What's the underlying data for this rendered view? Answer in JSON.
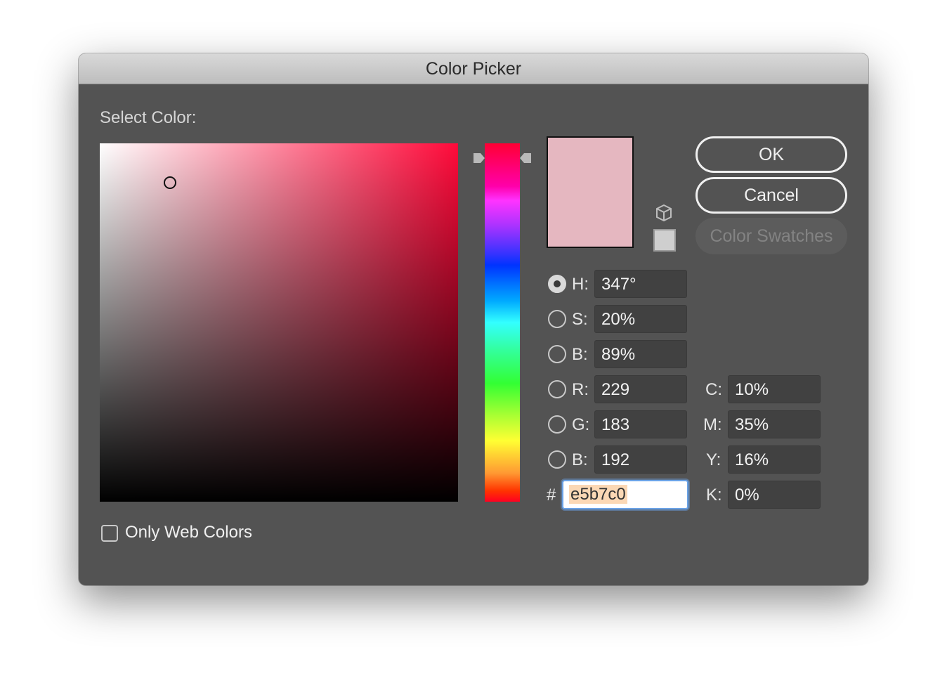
{
  "window": {
    "title": "Color Picker"
  },
  "picker": {
    "select_label": "Select Color:"
  },
  "swatch": {
    "new_color": "#e5b7c0"
  },
  "buttons": {
    "ok": "OK",
    "cancel": "Cancel",
    "color_swatches": "Color Swatches"
  },
  "hsb": {
    "h_label": "H:",
    "h_value": "347°",
    "s_label": "S:",
    "s_value": "20%",
    "b_label": "B:",
    "b_value": "89%"
  },
  "rgb": {
    "r_label": "R:",
    "r_value": "229",
    "g_label": "G:",
    "g_value": "183",
    "b_label": "B:",
    "b_value": "192"
  },
  "cmyk": {
    "c_label": "C:",
    "c_value": "10%",
    "m_label": "M:",
    "m_value": "35%",
    "y_label": "Y:",
    "y_value": "16%",
    "k_label": "K:",
    "k_value": "0%"
  },
  "hex": {
    "label": "#",
    "value": "e5b7c0"
  },
  "web_colors": {
    "label": "Only Web Colors",
    "checked": false
  },
  "selected_mode": "H",
  "icons": [
    "cube-icon",
    "hue-arrow-left-icon",
    "hue-arrow-right-icon"
  ]
}
